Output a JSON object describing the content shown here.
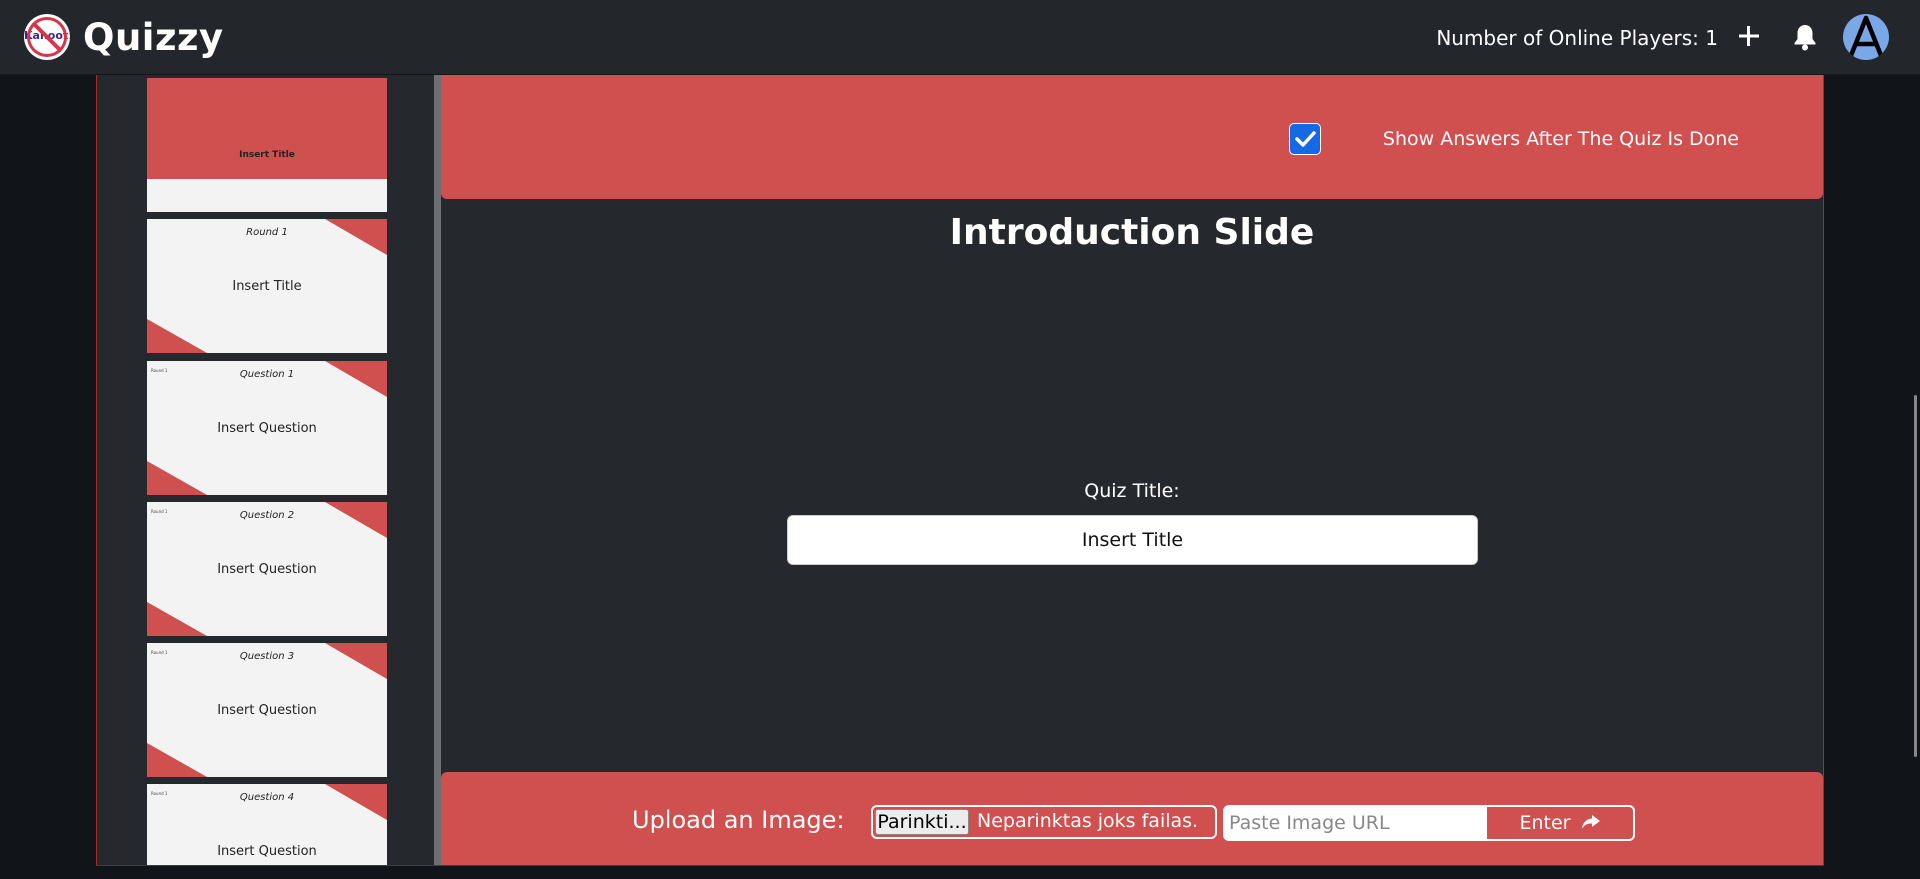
{
  "header": {
    "brand": "Quizzy",
    "logo_text": "Kahoot!",
    "online_players": "Number of Online Players: 1",
    "add_icon": "plus-icon",
    "notification_icon": "bell-icon",
    "avatar_letter": "A"
  },
  "slides": [
    {
      "title": "",
      "body": "Insert Title",
      "corner": ""
    },
    {
      "title": "Round 1",
      "body": "Insert Title",
      "corner": ""
    },
    {
      "title": "Question 1",
      "body": "Insert Question",
      "corner": "Round 1"
    },
    {
      "title": "Question 2",
      "body": "Insert Question",
      "corner": "Round 1"
    },
    {
      "title": "Question 3",
      "body": "Insert Question",
      "corner": "Round 1"
    },
    {
      "title": "Question 4",
      "body": "Insert Question",
      "corner": "Round 1"
    }
  ],
  "editor": {
    "show_answers_label": "Show Answers After The Quiz Is Done",
    "show_answers_checked": true,
    "slide_heading": "Introduction Slide",
    "quiz_title_label": "Quiz Title:",
    "quiz_title_value": "Insert Title"
  },
  "upload": {
    "label": "Upload an Image:",
    "file_button": "Parinkti...",
    "file_status": "Neparinktas joks failas.",
    "url_placeholder": "Paste Image URL",
    "enter_button": "Enter"
  },
  "colors": {
    "accent_red": "#d04f4f",
    "nav_bg": "#23262b",
    "checkbox_blue": "#1669e6"
  }
}
